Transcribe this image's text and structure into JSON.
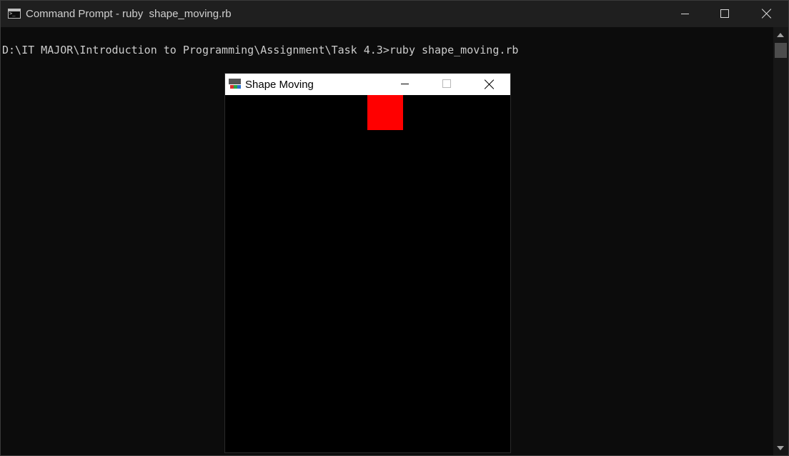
{
  "console_window": {
    "title": "Command Prompt - ruby  shape_moving.rb",
    "icon": "console-icon",
    "controls": [
      "minimize-icon",
      "maximize-icon",
      "close-icon"
    ]
  },
  "console": {
    "lines": [
      "D:\\IT MAJOR\\Introduction to Programming\\Assignment\\Task 4.3>ruby shape_moving.rb"
    ]
  },
  "game_window": {
    "title": "Shape Moving",
    "icon": "ruby-gosu-icon",
    "background_color": "#000000",
    "shape_color": "#ff0000"
  },
  "colors": {
    "console_background": "#0c0c0c",
    "console_text": "#cccccc",
    "titlebar_dark": "#1f1f1f",
    "titlebar_light": "#ffffff"
  }
}
